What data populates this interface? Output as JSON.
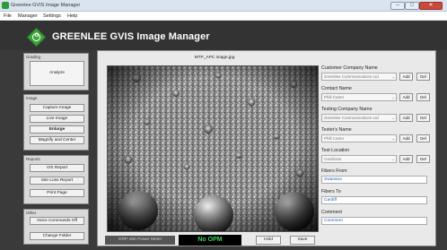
{
  "window": {
    "title": "Greenlee GVIS Image Manager",
    "minimize": "–",
    "maximize": "□",
    "close": "✕"
  },
  "menu": [
    "File",
    "Manager",
    "Settings",
    "Help"
  ],
  "header": {
    "logo_letter": "G",
    "title": "GREENLEE GVIS Image Manager"
  },
  "sidebar": {
    "grading": {
      "label": "Grading",
      "analyze": "Analyze"
    },
    "image": {
      "label": "Image",
      "capture": "Capture Image",
      "live": "Live Image",
      "enlarge": "Enlarge",
      "magnify": "Magnify and Center"
    },
    "reports": {
      "label": "Reports",
      "vis": "VIS Report",
      "site_loss": "Site Loss Report",
      "print": "Print Page"
    },
    "other": {
      "label": "Other",
      "voice": "Voice Commands Off",
      "change_folder": "Change Folder"
    }
  },
  "main": {
    "image_caption": "MTP_APC image.jpg",
    "power_meter": {
      "label": "GRP-460 Power Meter",
      "reading": "No OPM",
      "hold": "Hold",
      "save": "Save"
    }
  },
  "form": {
    "customer": {
      "label": "Customer Company Name",
      "value": "Greenlee Communications Ltd",
      "add": "Add",
      "del": "Del"
    },
    "contact": {
      "label": "Contact Name",
      "value": "Phill Carter",
      "add": "Add",
      "del": "Del"
    },
    "testing": {
      "label": "Testing Company Name",
      "value": "Greenlee Communications Ltd",
      "add": "Add",
      "del": "Del"
    },
    "tester": {
      "label": "Tester's Name",
      "value": "Phill Carter",
      "add": "Add",
      "del": "Del"
    },
    "location": {
      "label": "Test Location",
      "value": "Cwmbran",
      "add": "Add",
      "del": "Del"
    },
    "fibers_from": {
      "label": "Fibers From",
      "value": "Swansea"
    },
    "fibers_to": {
      "label": "Fibers To",
      "value": "Cardiff"
    },
    "comment": {
      "label": "Comment",
      "value": "Comment"
    },
    "combo_arrow": "⌄"
  }
}
